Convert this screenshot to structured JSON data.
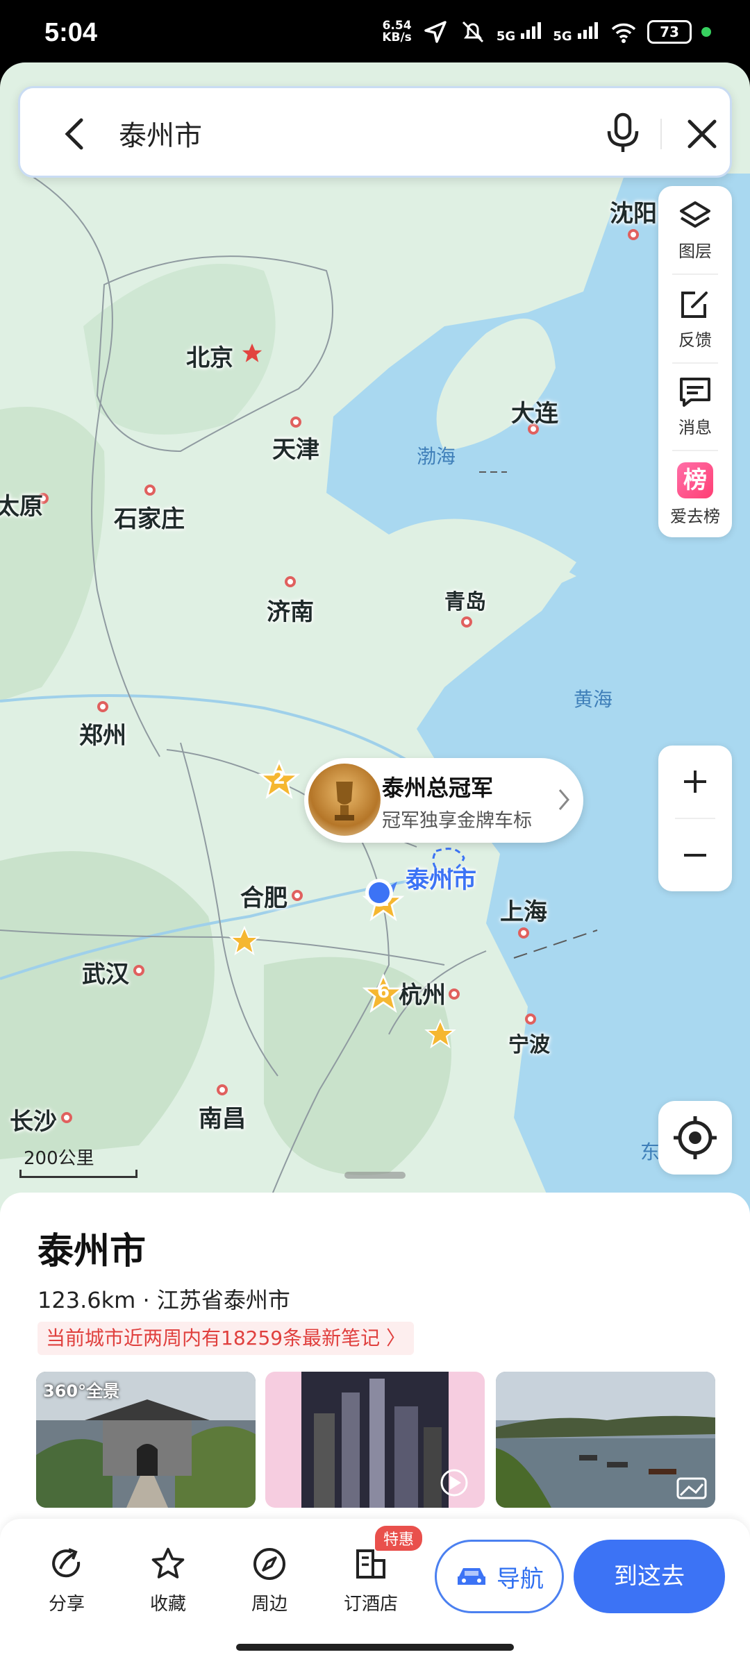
{
  "status_bar": {
    "time": "5:04",
    "net_speed_value": "6.54",
    "net_speed_unit": "KB/s",
    "sig1": "5G",
    "sig2": "5G",
    "battery": "73"
  },
  "search": {
    "query": "泰州市"
  },
  "tools": {
    "layers": "图层",
    "feedback": "反馈",
    "messages": "消息",
    "ranking_badge": "榜",
    "ranking": "爱去榜"
  },
  "map": {
    "cities": {
      "shenyang": "沈阳",
      "beijing": "北京",
      "dalian": "大连",
      "tianjin": "天津",
      "taiyuan": "太原",
      "shijiazhuang": "石家庄",
      "jinan": "济南",
      "qingdao": "青岛",
      "zhengzhou": "郑州",
      "hefei": "合肥",
      "taizhou": "泰州市",
      "shanghai": "上海",
      "wuhan": "武汉",
      "hangzhou": "杭州",
      "ningbo": "宁波",
      "changsha": "长沙",
      "nanchang": "南昌",
      "dong": "东"
    },
    "seas": {
      "bohai": "渤海",
      "huanghai": "黄海"
    },
    "markers": {
      "m2": "2",
      "m6": "6",
      "m_taizhou": "2"
    },
    "scale": "200公里",
    "callout": {
      "title": "泰州总冠军",
      "subtitle": "冠军独享金牌车标"
    }
  },
  "sheet": {
    "title": "泰州市",
    "subtitle": "123.6km · 江苏省泰州市",
    "notes": "当前城市近两周内有18259条最新笔记 〉",
    "photo_badge": "360°全景"
  },
  "actions": {
    "share": "分享",
    "favorite": "收藏",
    "nearby": "周边",
    "hotel": "订酒店",
    "hotel_badge": "特惠",
    "navigate": "导航",
    "go": "到这去"
  },
  "colors": {
    "accent": "#3c73f5",
    "sea": "#a9d8f0",
    "land": "#dff0e3",
    "red": "#e0403e"
  }
}
